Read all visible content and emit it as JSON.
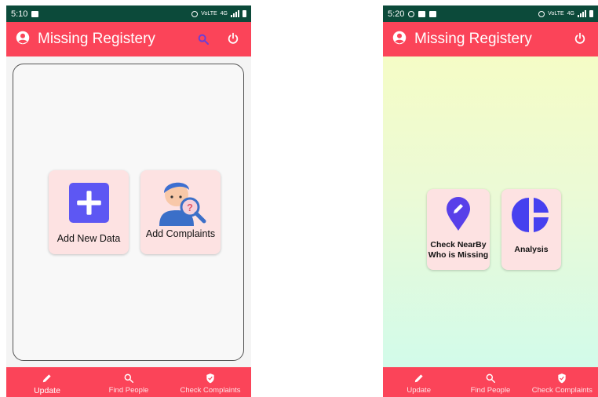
{
  "colors": {
    "accent": "#fb4459",
    "statusbar": "#0c4a3a",
    "card": "#fde2e2",
    "plus_tile": "#5d57f3",
    "pin": "#5840e9",
    "analysis": "#4640ef"
  },
  "screens": [
    {
      "status": {
        "time": "5:10",
        "net_a": "VoLTE",
        "net_b": "4G"
      },
      "app_title": "Missing Registery",
      "actions": [
        {
          "icon": "search-icon"
        },
        {
          "icon": "power-icon"
        }
      ],
      "cards": [
        {
          "label": "Add New Data",
          "icon": "plus-square-icon"
        },
        {
          "label": "Add Complaints",
          "icon": "person-search-icon"
        }
      ],
      "nav": [
        {
          "label": "Update",
          "icon": "pencil-icon"
        },
        {
          "label": "Find People",
          "icon": "search-icon"
        },
        {
          "label": "Check Complaints",
          "icon": "shield-icon"
        }
      ]
    },
    {
      "status": {
        "time": "5:20",
        "net_a": "VoLTE",
        "net_b": "4G"
      },
      "app_title": "Missing Registery",
      "actions": [
        {
          "icon": "power-icon"
        }
      ],
      "cards": [
        {
          "label": "Check NearBy Who is Missing",
          "icon": "location-pin-icon"
        },
        {
          "label": "Analysis",
          "icon": "pie-chart-icon"
        }
      ],
      "nav": [
        {
          "label": "Update",
          "icon": "pencil-icon"
        },
        {
          "label": "Find People",
          "icon": "search-icon"
        },
        {
          "label": "Check Complaints",
          "icon": "shield-icon"
        }
      ]
    }
  ]
}
